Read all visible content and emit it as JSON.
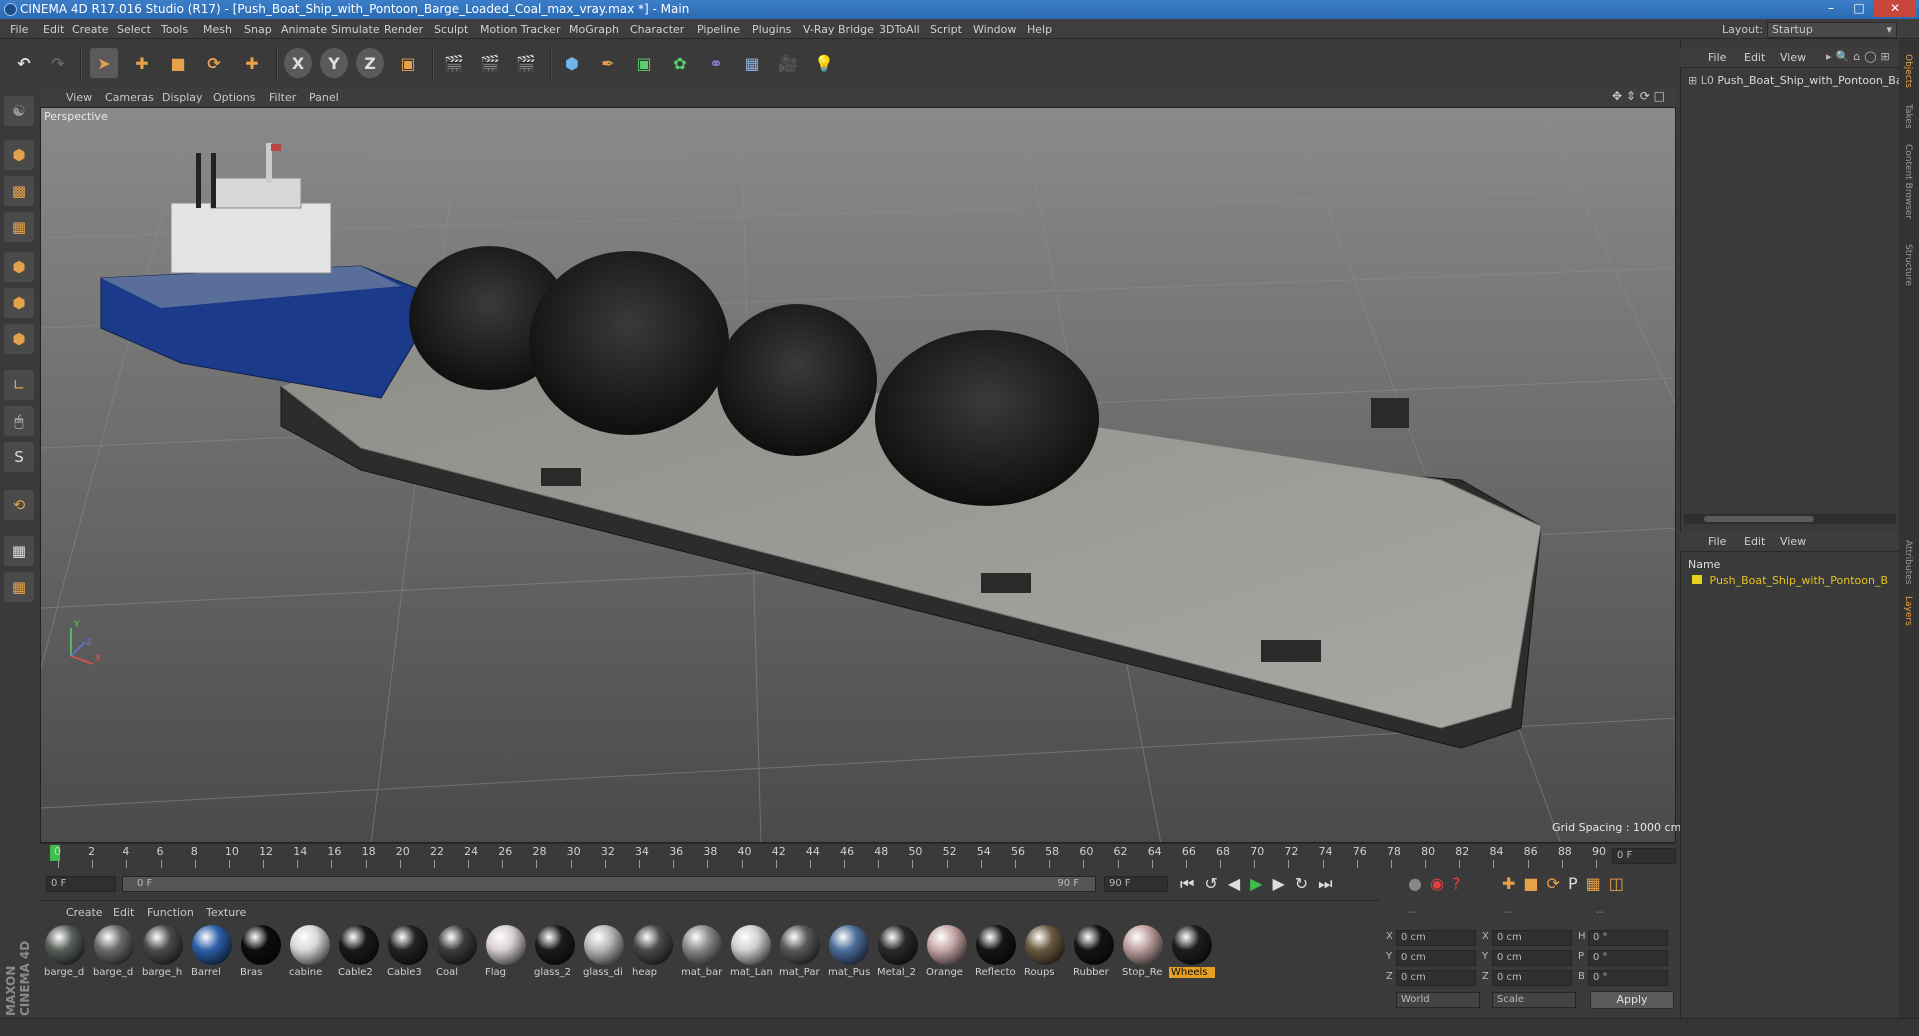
{
  "window": {
    "title": "CINEMA 4D R17.016 Studio (R17) - [Push_Boat_Ship_with_Pontoon_Barge_Loaded_Coal_max_vray.max *] - Main"
  },
  "menus": [
    "File",
    "Edit",
    "Create",
    "Select",
    "Tools",
    "Mesh",
    "Snap",
    "Animate",
    "Simulate",
    "Render",
    "Sculpt",
    "Motion Tracker",
    "MoGraph",
    "Character",
    "Pipeline",
    "Plugins",
    "V-Ray Bridge",
    "3DToAll",
    "Script",
    "Window",
    "Help"
  ],
  "layout": {
    "label": "Layout:",
    "value": "Startup"
  },
  "viewport": {
    "menus": [
      "View",
      "Cameras",
      "Display",
      "Options",
      "Filter",
      "Panel"
    ],
    "label": "Perspective",
    "grid_spacing": "Grid Spacing : 1000 cm",
    "axes": {
      "x": "X",
      "y": "Y",
      "z": "Z"
    }
  },
  "objects_panel": {
    "menus": [
      "File",
      "Edit",
      "View"
    ],
    "items": [
      {
        "name": "Push_Boat_Ship_with_Pontoon_Ba"
      }
    ]
  },
  "layers_panel": {
    "menus": [
      "File",
      "Edit",
      "View"
    ],
    "header": "Name",
    "items": [
      {
        "name": "Push_Boat_Ship_with_Pontoon_B",
        "color": "#e6d020"
      }
    ]
  },
  "side_tabs": [
    "Objects",
    "Takes",
    "Content Browser",
    "Structure",
    "Attributes",
    "Layers"
  ],
  "timeline": {
    "ticks": [
      "0",
      "2",
      "4",
      "6",
      "8",
      "10",
      "12",
      "14",
      "16",
      "18",
      "20",
      "22",
      "24",
      "26",
      "28",
      "30",
      "32",
      "34",
      "36",
      "38",
      "40",
      "42",
      "44",
      "46",
      "48",
      "50",
      "52",
      "54",
      "56",
      "58",
      "60",
      "62",
      "64",
      "66",
      "68",
      "70",
      "72",
      "74",
      "76",
      "78",
      "80",
      "82",
      "84",
      "86",
      "88",
      "90"
    ],
    "current_frame_end": "0 F"
  },
  "transport": {
    "start_field": "0 F",
    "range_start": "0 F",
    "range_end": "90 F",
    "end_field": "90 F"
  },
  "material_panel": {
    "menus": [
      "Create",
      "Edit",
      "Function",
      "Texture"
    ],
    "materials": [
      {
        "label": "barge_d",
        "color": "#5a5f5a"
      },
      {
        "label": "barge_d",
        "color": "#6b6b6b"
      },
      {
        "label": "barge_h",
        "color": "#4c4c4c"
      },
      {
        "label": "Barrel",
        "color": "#2d5fa8"
      },
      {
        "label": "Bras",
        "color": "#0d0d0d"
      },
      {
        "label": "cabine",
        "color": "#d8d8d8"
      },
      {
        "label": "Cable2",
        "color": "#1a1a1a"
      },
      {
        "label": "Cable3",
        "color": "#222222"
      },
      {
        "label": "Coal",
        "color": "#3c3c3c"
      },
      {
        "label": "Flag",
        "color": "#d8d0d0"
      },
      {
        "label": "glass_2",
        "color": "#1c1c1c"
      },
      {
        "label": "glass_di",
        "color": "#b8b8b8"
      },
      {
        "label": "heap",
        "color": "#4a4a4a"
      },
      {
        "label": "mat_bar",
        "color": "#8a8a8a"
      },
      {
        "label": "mat_Lan",
        "color": "#d0d0d0"
      },
      {
        "label": "mat_Par",
        "color": "#5a5a5a"
      },
      {
        "label": "mat_Pus",
        "color": "#4d6e9c"
      },
      {
        "label": "Metal_2",
        "color": "#2a2a2a"
      },
      {
        "label": "Orange",
        "color": "#c8a8a8"
      },
      {
        "label": "Reflecto",
        "color": "#151515"
      },
      {
        "label": "Roups",
        "color": "#6a5a40"
      },
      {
        "label": "Rubber",
        "color": "#141414"
      },
      {
        "label": "Stop_Re",
        "color": "#bfa0a0"
      },
      {
        "label": "Wheels",
        "color": "#1e1e1e",
        "selected": true
      }
    ]
  },
  "coords": {
    "headers": [
      "--",
      "--",
      "--"
    ],
    "rows": [
      {
        "a": "X",
        "av": "0 cm",
        "b": "X",
        "bv": "0 cm",
        "c": "H",
        "cv": "0 °"
      },
      {
        "a": "Y",
        "av": "0 cm",
        "b": "Y",
        "bv": "0 cm",
        "c": "P",
        "cv": "0 °"
      },
      {
        "a": "Z",
        "av": "0 cm",
        "b": "Z",
        "bv": "0 cm",
        "c": "B",
        "cv": "0 °"
      }
    ],
    "mode1": "World",
    "mode2": "Scale",
    "apply": "Apply"
  },
  "brand": "MAXON CINEMA 4D"
}
